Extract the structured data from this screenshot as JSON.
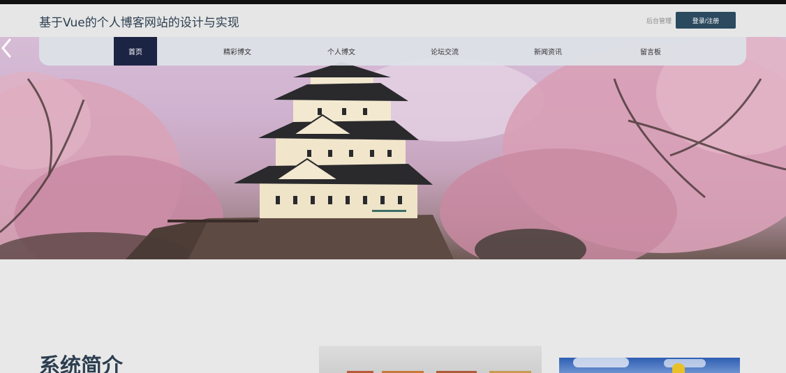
{
  "header": {
    "site_title": "基于Vue的个人博客网站的设计与实现",
    "admin_link": "后台管理",
    "login_button": "登录/注册"
  },
  "nav": {
    "items": [
      {
        "label": "首页",
        "active": true
      },
      {
        "label": "精彩博文",
        "active": false
      },
      {
        "label": "个人博文",
        "active": false
      },
      {
        "label": "论坛交流",
        "active": false
      },
      {
        "label": "新闻资讯",
        "active": false
      },
      {
        "label": "留言板",
        "active": false
      }
    ]
  },
  "carousel": {
    "icons": {
      "next": "chevron-right-icon"
    },
    "active_slide": 1
  },
  "intro": {
    "title": "系统简介"
  },
  "colors": {
    "accent": "#2b4a5f",
    "nav_active": "#1c2444",
    "title": "#2c3e50"
  }
}
